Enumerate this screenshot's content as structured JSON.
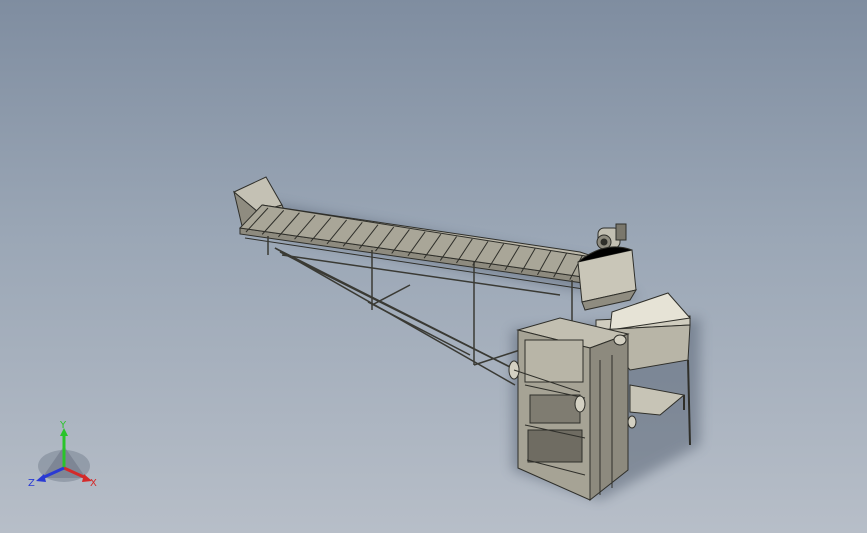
{
  "viewport": {
    "background_top": "#7f8da0",
    "background_bottom": "#b7bec8"
  },
  "model": {
    "metal_color": "#a9a698",
    "edge_color": "#2f2f2a",
    "shadow_color": "#5e6878"
  },
  "triad": {
    "x_label": "X",
    "y_label": "Y",
    "z_label": "Z",
    "x_color": "#d42a2a",
    "y_color": "#2ac42a",
    "z_color": "#2a3ad4"
  }
}
